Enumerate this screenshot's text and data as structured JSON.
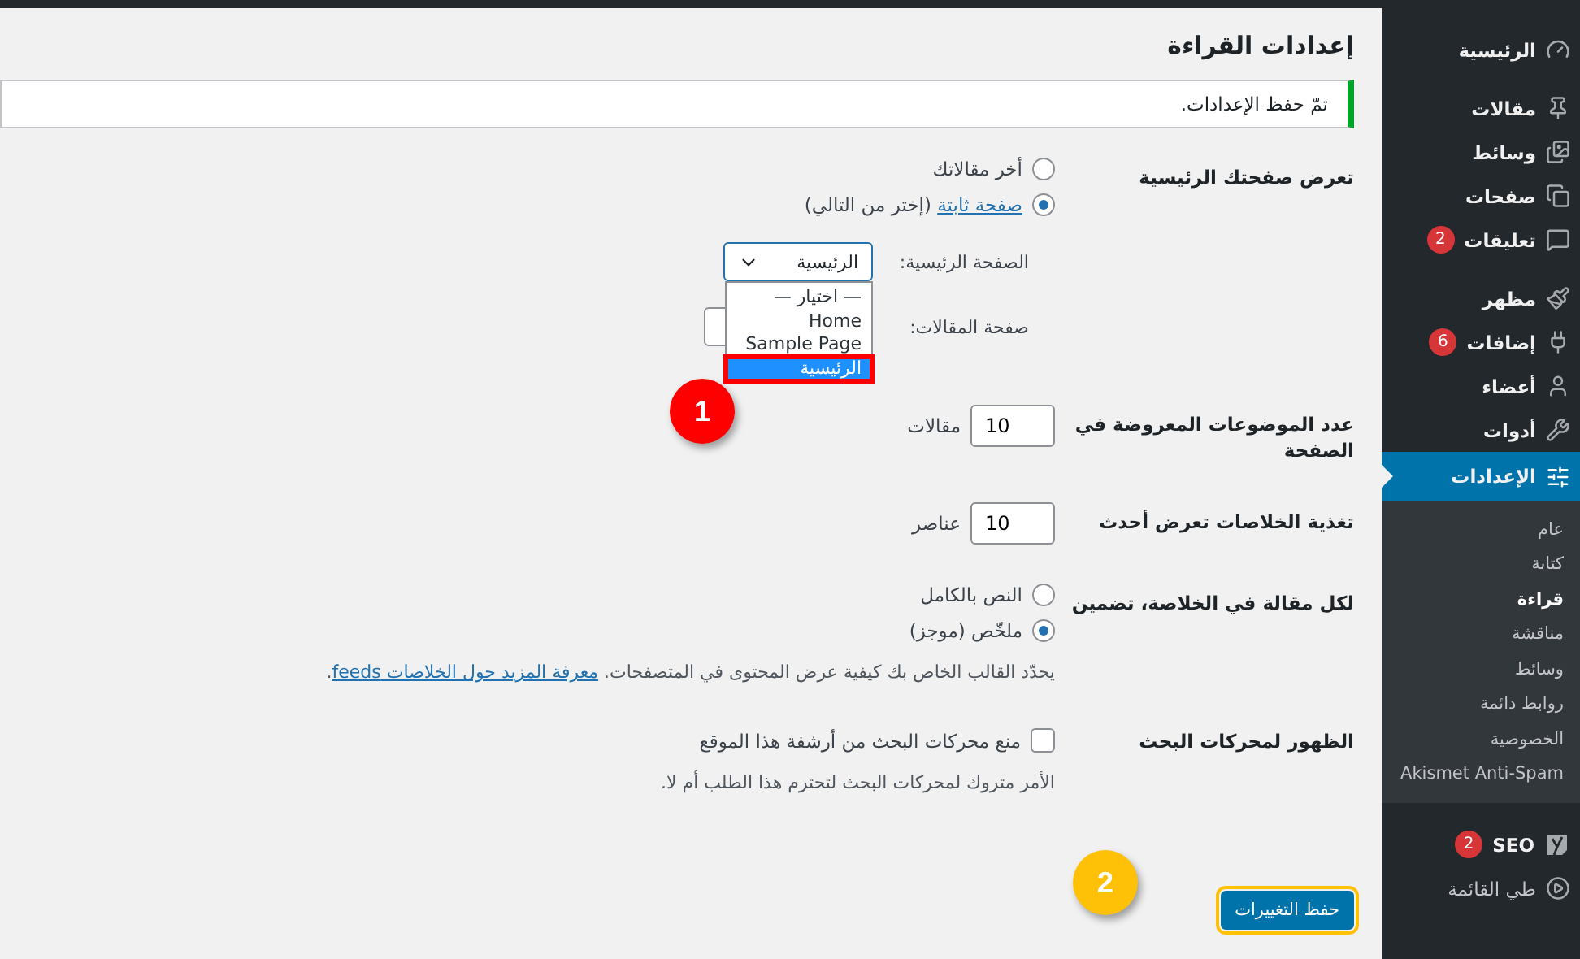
{
  "sidebar": {
    "items": [
      {
        "label": "الرئيسية",
        "selected": false
      },
      {
        "label": "مقالات",
        "selected": false
      },
      {
        "label": "وسائط",
        "selected": false
      },
      {
        "label": "صفحات",
        "selected": false
      },
      {
        "label": "تعليقات",
        "badge": "2",
        "selected": false
      },
      {
        "label": "مظهر",
        "selected": false
      },
      {
        "label": "إضافات",
        "badge": "6",
        "selected": false
      },
      {
        "label": "أعضاء",
        "selected": false
      },
      {
        "label": "أدوات",
        "selected": false
      },
      {
        "label": "الإعدادات",
        "selected": true,
        "children": [
          {
            "label": "عام",
            "selected": false
          },
          {
            "label": "كتابة",
            "selected": false
          },
          {
            "label": "قراءة",
            "selected": true
          },
          {
            "label": "مناقشة",
            "selected": false
          },
          {
            "label": "وسائط",
            "selected": false
          },
          {
            "label": "روابط دائمة",
            "selected": false
          },
          {
            "label": "الخصوصية",
            "selected": false
          },
          {
            "label": "Akismet Anti-Spam",
            "selected": false
          }
        ]
      },
      {
        "label": "SEO",
        "badge": "2",
        "selected": false
      },
      {
        "label": "طي القائمة",
        "selected": false
      }
    ]
  },
  "page_title": "إعدادات القراءة",
  "notice": "تمّ حفظ الإعدادات.",
  "settings": [
    {
      "kind": "radios",
      "label": "تعرض صفحتك الرئيسية",
      "options": [
        {
          "text": "أخر مقالاتك",
          "selected": false
        },
        {
          "link": "صفحة ثابتة",
          "text": "(إختر من التالي)",
          "selected": true
        }
      ],
      "selects": [
        {
          "label": "الصفحة الرئيسية:",
          "value": "الرئيسية",
          "expanded": true,
          "options": [
            {
              "text": "— اختيار —",
              "selected": false
            },
            {
              "text": "Home",
              "selected": false
            },
            {
              "text": "Sample Page",
              "selected": false
            },
            {
              "text": "الرئيسية",
              "selected": true
            }
          ]
        },
        {
          "label": "صفحة المقالات:",
          "expanded": false
        }
      ]
    },
    {
      "kind": "number",
      "label": "عدد الموضوعات المعروضة في الصفحة",
      "value": "10",
      "unit": "مقالات"
    },
    {
      "kind": "number",
      "label": "تغذية الخلاصات تعرض أحدث",
      "value": "10",
      "unit": "عناصر"
    },
    {
      "kind": "radios",
      "label": "لكل مقالة في الخلاصة، تضمين",
      "options": [
        {
          "text": "النص بالكامل",
          "selected": false
        },
        {
          "text": "ملخّص (موجز)",
          "selected": true
        }
      ],
      "description": {
        "text": "يحدّد القالب الخاص بك كيفية عرض المحتوى في المتصفحات.",
        "link": "معرفة المزيد حول الخلاصات feeds",
        "after": "."
      }
    },
    {
      "kind": "checkbox",
      "label": "الظهور لمحركات البحث",
      "text": "منع محركات البحث من أرشفة هذا الموقع",
      "checked": false,
      "description": {
        "text": "الأمر متروك لمحركات البحث لتحترم هذا الطلب أم لا."
      }
    }
  ],
  "save_button": "حفظ التغييرات",
  "annotations": [
    {
      "label": "1",
      "color": "#ff0000"
    },
    {
      "label": "2",
      "color": "#ffc107"
    }
  ]
}
